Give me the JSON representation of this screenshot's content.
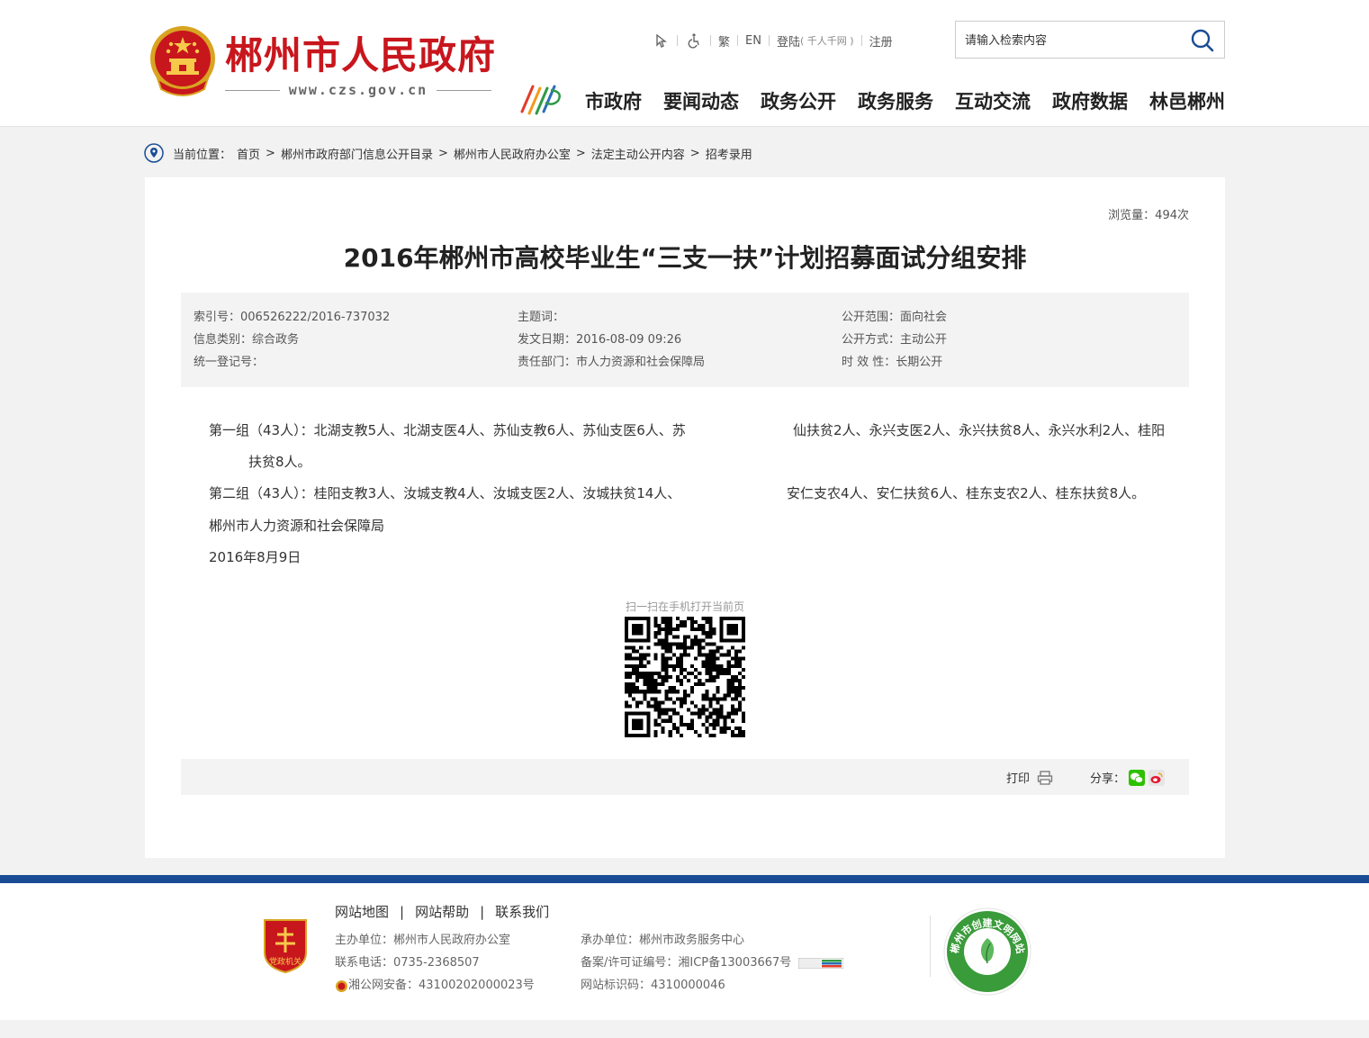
{
  "header": {
    "site_name": "郴州市人民政府",
    "site_url": "www.czs.gov.cn",
    "toplinks": {
      "traditional": "繁",
      "english": "EN",
      "login": "登陆",
      "login_note": "( 千人千网 )",
      "register": "注册"
    },
    "search": {
      "placeholder": "请输入检索内容"
    },
    "nav": [
      "市政府",
      "要闻动态",
      "政务公开",
      "政务服务",
      "互动交流",
      "政府数据",
      "林邑郴州"
    ]
  },
  "breadcrumb": {
    "label": "当前位置：",
    "items": [
      "首页",
      "郴州市政府部门信息公开目录",
      "郴州市人民政府办公室",
      "法定主动公开内容",
      "招考录用"
    ]
  },
  "article": {
    "views": "浏览量：494次",
    "title": "2016年郴州市高校毕业生“三支一扶”计划招募面试分组安排",
    "meta": {
      "index_no": "索引号：006526222/2016-737032",
      "category": "信息类别：综合政务",
      "reg_no": "统一登记号：",
      "subject": "主题词：",
      "pub_date": "发文日期：2016-08-09 09:26",
      "dept": "责任部门：市人力资源和社会保障局",
      "scope": "公开范围：面向社会",
      "method": "公开方式：主动公开",
      "validity": "时 效 性：长期公开"
    },
    "body": {
      "g1_a": "第一组（43人）：北湖支教5人、北湖支医4人、苏仙支教6人、苏仙支医6人、苏",
      "g1_b": "仙扶贫2人、永兴支医2人、永兴扶贫8人、永兴水利2人、桂阳",
      "g1_c": "扶贫8人。",
      "g2_a": "第二组（43人）：桂阳支教3人、汝城支教4人、汝城支医2人、汝城扶贫14人、",
      "g2_b": "安仁支农4人、安仁扶贫6人、桂东支农2人、桂东扶贫8人。",
      "sign": "郴州市人力资源和社会保障局",
      "date": "2016年8月9日"
    },
    "qr_caption": "扫一扫在手机打开当前页",
    "print": "打印",
    "share": "分享："
  },
  "footer": {
    "links": [
      "网站地图",
      "网站帮助",
      "联系我们"
    ],
    "sponsor": "主办单位：郴州市人民政府办公室",
    "phone": "联系电话：0735-2368507",
    "police": "湘公网安备：43100202000023号",
    "organizer": "承办单位：郴州市政务服务中心",
    "icp": "备案/许可证编号：湘ICP备13003667号",
    "site_id": "网站标识码：4310000046",
    "party_badge_text": "党政机关",
    "civ_badge_text": "郴州市创建文明网站"
  },
  "colors": {
    "brand_red": "#c8161d",
    "footer_blue": "#1a4c95",
    "background": "#f1f2f1"
  }
}
